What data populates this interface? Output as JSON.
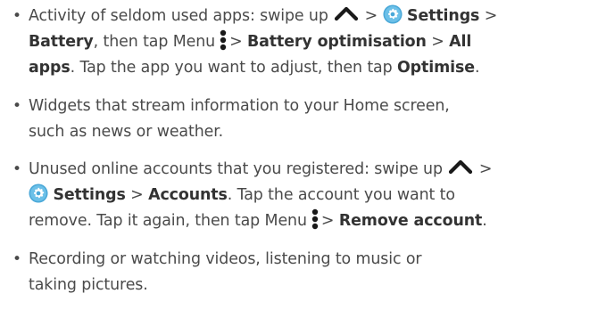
{
  "items": [
    {
      "t1": "Activity of seldom used apps: swipe up",
      "t2": ">",
      "settings": "Settings",
      "t3": ">",
      "battery": "Battery",
      "t4": ", then tap Menu",
      "t5": ">",
      "battery_opt": "Battery optimisation",
      "t6": ">",
      "all": "All",
      "apps": "apps",
      "t7": ". Tap the app you want to adjust, then tap",
      "optimise": "Optimise",
      "t8": "."
    },
    {
      "l1": "Widgets that stream information to your Home screen,",
      "l2": "such as news or weather."
    },
    {
      "t1": "Unused online accounts that you registered: swipe up",
      "t2": ">",
      "settings": "Settings",
      "t3": ">",
      "accounts": "Accounts",
      "t4": ". Tap the account you want to",
      "t5": "remove. Tap it again, then tap Menu",
      "t6": ">",
      "remove": "Remove account",
      "t7": "."
    },
    {
      "l1": "Recording or watching videos, listening to music or",
      "l2": "taking pictures."
    }
  ],
  "icons": {
    "chevron": "chevron-up-icon",
    "settings": "settings-gear-icon",
    "menu": "menu-dots-icon"
  },
  "colors": {
    "text": "#4a4a4a",
    "bold": "#333333",
    "gear": "#4aa8d8"
  }
}
